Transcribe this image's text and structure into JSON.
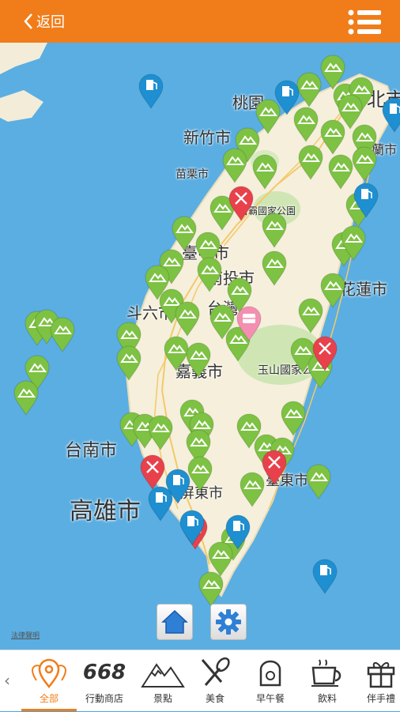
{
  "header": {
    "back_label": "返回",
    "menu_icon": "list-menu-icon",
    "bg_color": "#f07d1a"
  },
  "map": {
    "labels": {
      "taoyuan": "桃園",
      "taipei": "台北市",
      "hsinchu": "新竹市",
      "yilan": "宜蘭市",
      "miaoli": "苗栗市",
      "shei_pa": "雪霸國家公園",
      "taichung": "臺中市",
      "nantou": "南投市",
      "hualien": "花蓮市",
      "douliu": "斗六市",
      "taiwan": "台灣",
      "chiayi": "嘉義市",
      "yushan": "玉山國家公園",
      "tainan": "台南市",
      "kaohsiung": "高雄市",
      "pingtung": "屏東市",
      "taitung": "臺東市"
    },
    "legal_link": "法律聲明",
    "home_button_icon": "home-icon",
    "settings_button_icon": "gear-icon",
    "pin_colors": {
      "attraction": "#7dc242",
      "food": "#e8414c",
      "fuel": "#1e8fd0",
      "hotel": "#f48fb1"
    }
  },
  "bottom_nav": {
    "items": [
      {
        "label": "全部",
        "icon": "location-pins-icon",
        "active": true
      },
      {
        "label": "行動商店",
        "icon": "668-logo-icon",
        "active": false
      },
      {
        "label": "景點",
        "icon": "mountain-icon",
        "active": false
      },
      {
        "label": "美食",
        "icon": "fork-spoon-icon",
        "active": false
      },
      {
        "label": "早午餐",
        "icon": "toast-icon",
        "active": false
      },
      {
        "label": "飲料",
        "icon": "coffee-cup-icon",
        "active": false
      },
      {
        "label": "伴手禮",
        "icon": "gift-box-icon",
        "active": false
      }
    ],
    "logo_668": "668",
    "accent_color": "#f07d1a"
  }
}
